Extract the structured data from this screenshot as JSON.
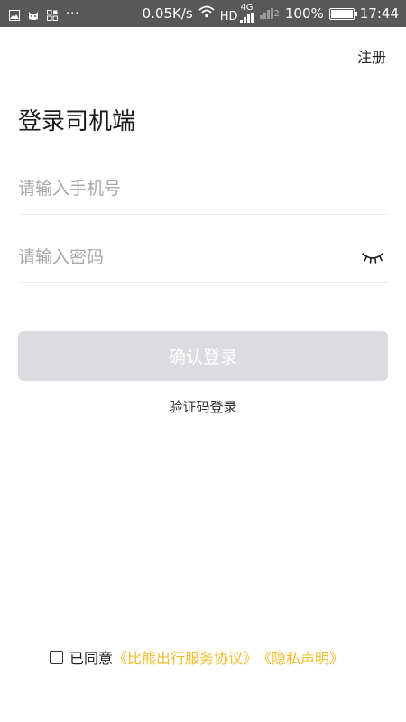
{
  "status_bar": {
    "notif_icons": [
      "image-icon",
      "cat-icon",
      "apps-icon"
    ],
    "more": "···",
    "speed": "0.05K/s",
    "hd": "HD",
    "net": "4G",
    "sim2": "2",
    "battery": "100%",
    "battery_level": 1.0,
    "time": "17:44"
  },
  "header": {
    "register": "注册"
  },
  "title": "登录司机端",
  "form": {
    "phone_placeholder": "请输入手机号",
    "phone_value": "",
    "password_placeholder": "请输入密码",
    "password_value": ""
  },
  "buttons": {
    "login": "确认登录",
    "code_login": "验证码登录"
  },
  "agreement": {
    "prefix": "已同意",
    "service": "《比熊出行服务协议》",
    "privacy": "《隐私声明》",
    "checked": false,
    "link_color": "#f1bd2a"
  }
}
